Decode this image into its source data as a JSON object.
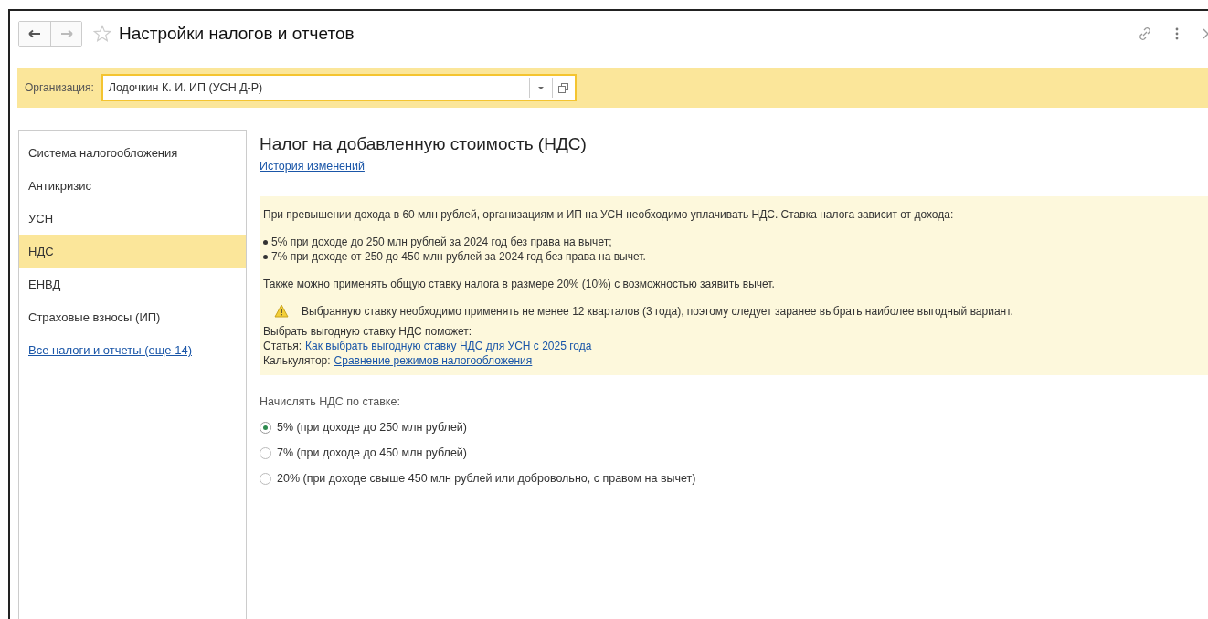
{
  "window": {
    "title": "Настройки налогов и отчетов"
  },
  "organization": {
    "label": "Организация:",
    "value": "Лодочкин К. И. ИП (УСН Д-Р)"
  },
  "sidebar": {
    "items": [
      {
        "label": "Система налогообложения",
        "selected": false
      },
      {
        "label": "Антикризис",
        "selected": false
      },
      {
        "label": "УСН",
        "selected": false
      },
      {
        "label": "НДС",
        "selected": true
      },
      {
        "label": "ЕНВД",
        "selected": false
      },
      {
        "label": "Страховые взносы (ИП)",
        "selected": false
      }
    ],
    "more_link": "Все налоги и отчеты (еще 14)"
  },
  "content": {
    "title": "Налог на добавленную стоимость (НДС)",
    "history_link": "История изменений",
    "info": {
      "intro": "При превышении дохода в 60 млн рублей, организациям и ИП на УСН необходимо уплачивать НДС. Ставка налога зависит от дохода:",
      "bullets": [
        "5% при доходе до 250 млн рублей за 2024 год без права на вычет;",
        "7% при доходе от 250 до 450 млн рублей за 2024 год без права на вычет."
      ],
      "general": "Также можно применять общую ставку налога в размере 20% (10%) с возможностью заявить вычет.",
      "warning": "Выбранную ставку необходимо применять не менее 12 кварталов (3 года), поэтому следует заранее выбрать наиболее выгодный вариант.",
      "help_title": "Выбрать выгодную ставку НДС поможет:",
      "links": [
        {
          "label": "Статья:",
          "link": "Как выбрать выгодную ставку НДС для УСН с 2025 года"
        },
        {
          "label": "Калькулятор:",
          "link": "Сравнение режимов налогообложения"
        }
      ]
    },
    "rate_label": "Начислять НДС по ставке:",
    "rates": [
      {
        "label": "5% (при доходе до 250 млн рублей)",
        "selected": true
      },
      {
        "label": "7% (при доходе до 450 млн рублей)",
        "selected": false
      },
      {
        "label": "20% (при доходе свыше 450 млн рублей или добровольно, с правом на вычет)",
        "selected": false
      }
    ]
  }
}
